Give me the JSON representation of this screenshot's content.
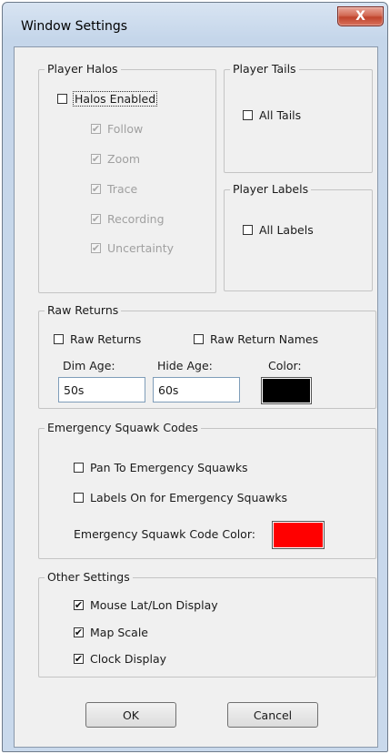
{
  "window": {
    "title": "Window Settings",
    "close_glyph": "X"
  },
  "player_halos": {
    "legend": "Player Halos",
    "halos_enabled": {
      "label": "Halos Enabled",
      "checked": false
    },
    "options": [
      {
        "label": "Follow",
        "checked": true,
        "enabled": false
      },
      {
        "label": "Zoom",
        "checked": true,
        "enabled": false
      },
      {
        "label": "Trace",
        "checked": true,
        "enabled": false
      },
      {
        "label": "Recording",
        "checked": true,
        "enabled": false
      },
      {
        "label": "Uncertainty",
        "checked": true,
        "enabled": false
      }
    ]
  },
  "player_tails": {
    "legend": "Player Tails",
    "all_tails": {
      "label": "All Tails",
      "checked": false
    }
  },
  "player_labels": {
    "legend": "Player Labels",
    "all_labels": {
      "label": "All Labels",
      "checked": false
    }
  },
  "raw_returns": {
    "legend": "Raw Returns",
    "raw_returns": {
      "label": "Raw Returns",
      "checked": false
    },
    "raw_return_names": {
      "label": "Raw Return Names",
      "checked": false
    },
    "dim_age_label": "Dim Age:",
    "dim_age_value": "50s",
    "hide_age_label": "Hide Age:",
    "hide_age_value": "60s",
    "color_label": "Color:",
    "color": "#000000"
  },
  "emergency": {
    "legend": "Emergency Squawk Codes",
    "pan_to": {
      "label": "Pan To Emergency Squawks",
      "checked": false
    },
    "labels_on": {
      "label": "Labels On for Emergency Squawks",
      "checked": false
    },
    "color_label": "Emergency Squawk Code Color:",
    "color": "#ff0000"
  },
  "other": {
    "legend": "Other Settings",
    "mouse_latlon": {
      "label": "Mouse Lat/Lon Display",
      "checked": true
    },
    "map_scale": {
      "label": "Map Scale",
      "checked": true
    },
    "clock_display": {
      "label": "Clock Display",
      "checked": true
    }
  },
  "buttons": {
    "ok": "OK",
    "cancel": "Cancel"
  },
  "glyphs": {
    "check": "✔"
  }
}
